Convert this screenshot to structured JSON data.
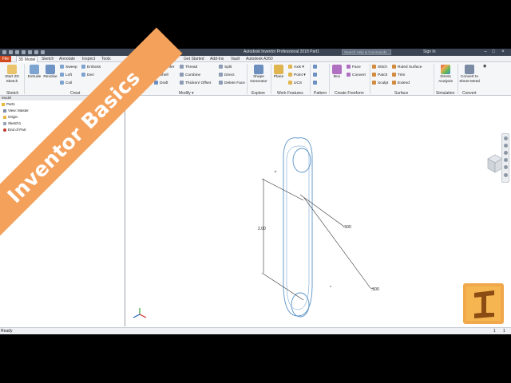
{
  "window": {
    "title": "Autodesk Inventor Professional 2018   Part1",
    "search_placeholder": "Search Help & Commands...",
    "sign_in": "Sign In"
  },
  "tabs": [
    {
      "label": "File"
    },
    {
      "label": "3D Model"
    },
    {
      "label": "Sketch"
    },
    {
      "label": "Annotate"
    },
    {
      "label": "Inspect"
    },
    {
      "label": "Tools"
    },
    {
      "label": "Get Started"
    },
    {
      "label": "Add-Ins"
    },
    {
      "label": "Vault"
    },
    {
      "label": "Autodesk A360"
    }
  ],
  "ribbon": {
    "start_sketch": "Start 2D Sketch",
    "sketch_group": "Sketch",
    "extrude": "Extrude",
    "revolve": "Revolve",
    "sweep": "Sweep",
    "loft": "Loft",
    "coil": "Coil",
    "emboss": "Emboss",
    "derive": "Deri",
    "create_group": "Creat",
    "chamfer": "Chamfer",
    "shell": "Shell",
    "draft": "Draft",
    "thread": "Thread",
    "combine": "Combine",
    "thicken": "Thicken/ Offset",
    "split": "Split",
    "direct": "Direct",
    "delete_face": "Delete Face",
    "modify_group": "Modify ▾",
    "shape_generator": "Shape Generator",
    "explore_group": "Explore",
    "plane": "Plane",
    "axis": "Axis ▾",
    "point": "Point ▾",
    "ucs": "UCS",
    "work_features_group": "Work Features",
    "pattern_group": "Pattern",
    "box": "Box",
    "face": "Face",
    "convert": "Convert",
    "create_freeform_group": "Create Freeform",
    "stitch": "Stitch",
    "patch": "Patch",
    "sculpt": "Sculpt",
    "ruled_surface": "Ruled Surface",
    "trim": "Trim",
    "extend": "Extend",
    "surface_group": "Surface",
    "stress_analysis": "Stress Analysis",
    "simulation_group": "Simulation",
    "convert_sheet_metal": "Convert to Sheet Metal",
    "convert_group": "Convert"
  },
  "browser": {
    "header": "Model",
    "items": [
      {
        "label": "Part1"
      },
      {
        "label": "View: Master"
      },
      {
        "label": "Origin"
      },
      {
        "label": "Sketch1"
      },
      {
        "label": "End of Part"
      }
    ]
  },
  "sketch": {
    "dims": [
      "2.00",
      ".500",
      ".500"
    ]
  },
  "status": {
    "text": "Ready",
    "page_a": "1",
    "page_b": "1"
  },
  "watermark": "Inventor Basics",
  "logo_letter": "I",
  "colors": {
    "file_tab": "#d14a1f",
    "banner": "#f4a15c",
    "logo": "#f0a84a",
    "sketch_profile": "#5a93c8"
  }
}
